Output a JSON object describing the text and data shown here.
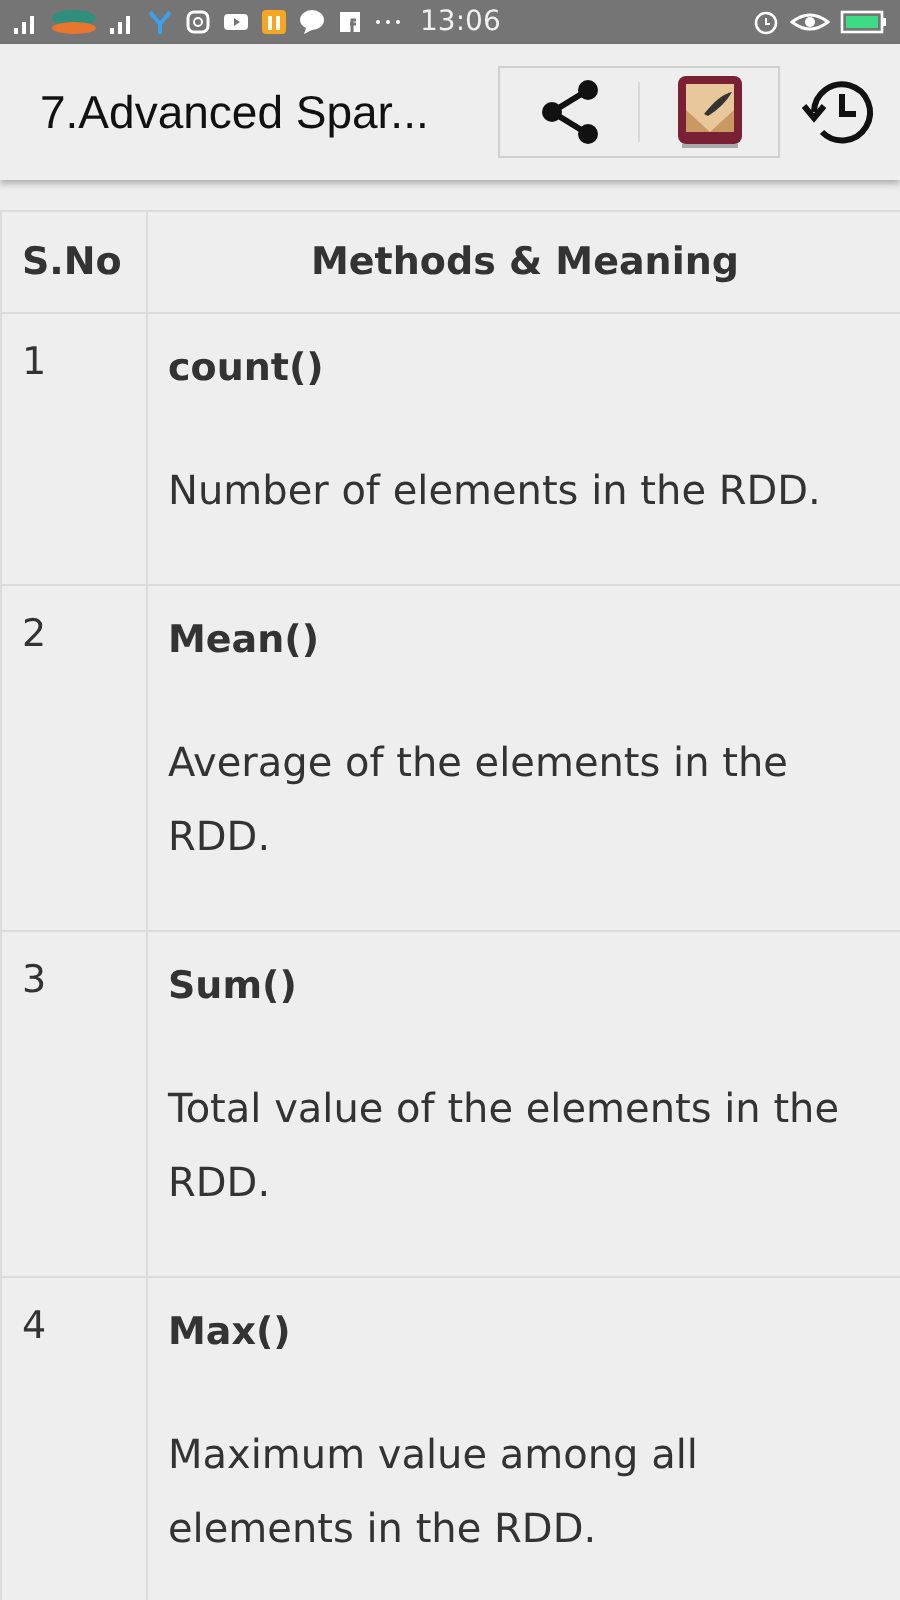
{
  "status_bar": {
    "time": "13:06"
  },
  "app_bar": {
    "title": "7.Advanced Spar..."
  },
  "table": {
    "columns": [
      "S.No",
      "Methods & Meaning"
    ],
    "rows": [
      {
        "number": "1",
        "method": "count()",
        "meaning": "Number of elements in the RDD."
      },
      {
        "number": "2",
        "method": "Mean()",
        "meaning": "Average of the elements in the RDD."
      },
      {
        "number": "3",
        "method": "Sum()",
        "meaning": "Total value of the elements in the RDD."
      },
      {
        "number": "4",
        "method": "Max()",
        "meaning": "Maximum value among all elements in the RDD."
      }
    ]
  }
}
